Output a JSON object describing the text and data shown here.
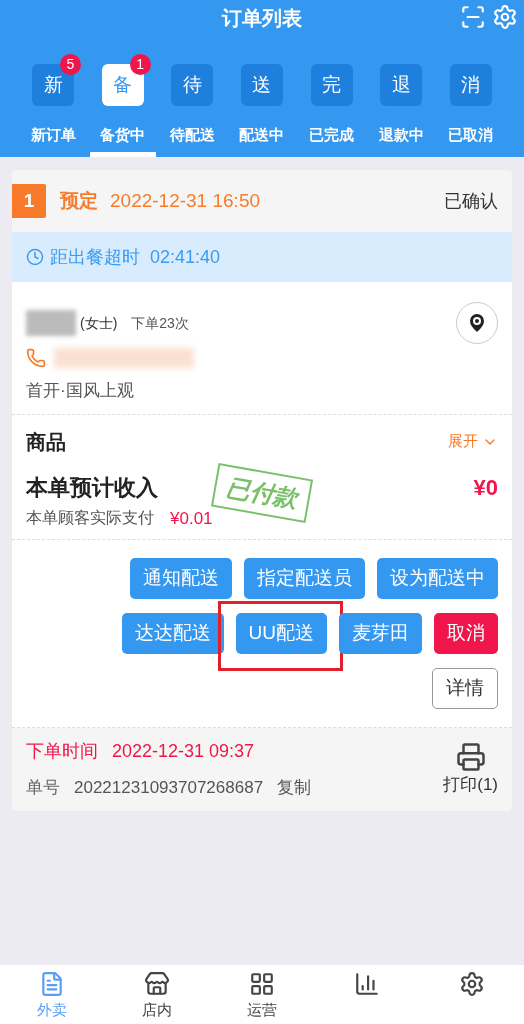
{
  "header": {
    "title": "订单列表"
  },
  "tabs": [
    {
      "icon": "新",
      "label": "新订单",
      "badge": "5",
      "selected": false
    },
    {
      "icon": "备",
      "label": "备货中",
      "badge": "1",
      "selected": true
    },
    {
      "icon": "待",
      "label": "待配送",
      "selected": false
    },
    {
      "icon": "送",
      "label": "配送中",
      "selected": false
    },
    {
      "icon": "完",
      "label": "已完成",
      "selected": false
    },
    {
      "icon": "退",
      "label": "退款中",
      "selected": false
    },
    {
      "icon": "消",
      "label": "已取消",
      "selected": false
    }
  ],
  "order": {
    "index": "1",
    "type": "预定",
    "time": "2022-12-31 16:50",
    "status": "已确认",
    "countdown": {
      "label": "距出餐超时",
      "value": "02:41:40"
    },
    "customer": {
      "title": "(女士)",
      "orders": "下单23次",
      "address": "首开·国风上观"
    },
    "goods": {
      "label": "商品",
      "toggle": "展开"
    },
    "income": {
      "label": "本单预计收入",
      "amount": "¥0",
      "paid_label": "本单顾客实际支付",
      "paid": "¥0.01",
      "stamp": "已付款"
    },
    "actions": [
      {
        "label": "通知配送",
        "kind": "primary",
        "highlighted": false
      },
      {
        "label": "指定配送员",
        "kind": "primary",
        "highlighted": false
      },
      {
        "label": "设为配送中",
        "kind": "primary",
        "highlighted": false
      },
      {
        "label": "达达配送",
        "kind": "primary",
        "highlighted": false
      },
      {
        "label": "UU配送",
        "kind": "primary",
        "highlighted": true
      },
      {
        "label": "麦芽田",
        "kind": "primary",
        "highlighted": false
      },
      {
        "label": "取消",
        "kind": "danger",
        "highlighted": false
      },
      {
        "label": "详情",
        "kind": "outline",
        "highlighted": false
      }
    ],
    "footer": {
      "time_label": "下单时间",
      "time": "2022-12-31 09:37",
      "number_label": "单号",
      "number": "20221231093707268687",
      "copy": "复制",
      "print": "打印(1)"
    }
  },
  "bottom_nav": [
    {
      "kind": "document",
      "label": "外卖",
      "selected": true
    },
    {
      "kind": "store",
      "label": "店内",
      "selected": false
    },
    {
      "kind": "grid",
      "label": "运营",
      "selected": false
    },
    {
      "kind": "chart",
      "selected": false
    },
    {
      "kind": "gear",
      "selected": false
    }
  ]
}
